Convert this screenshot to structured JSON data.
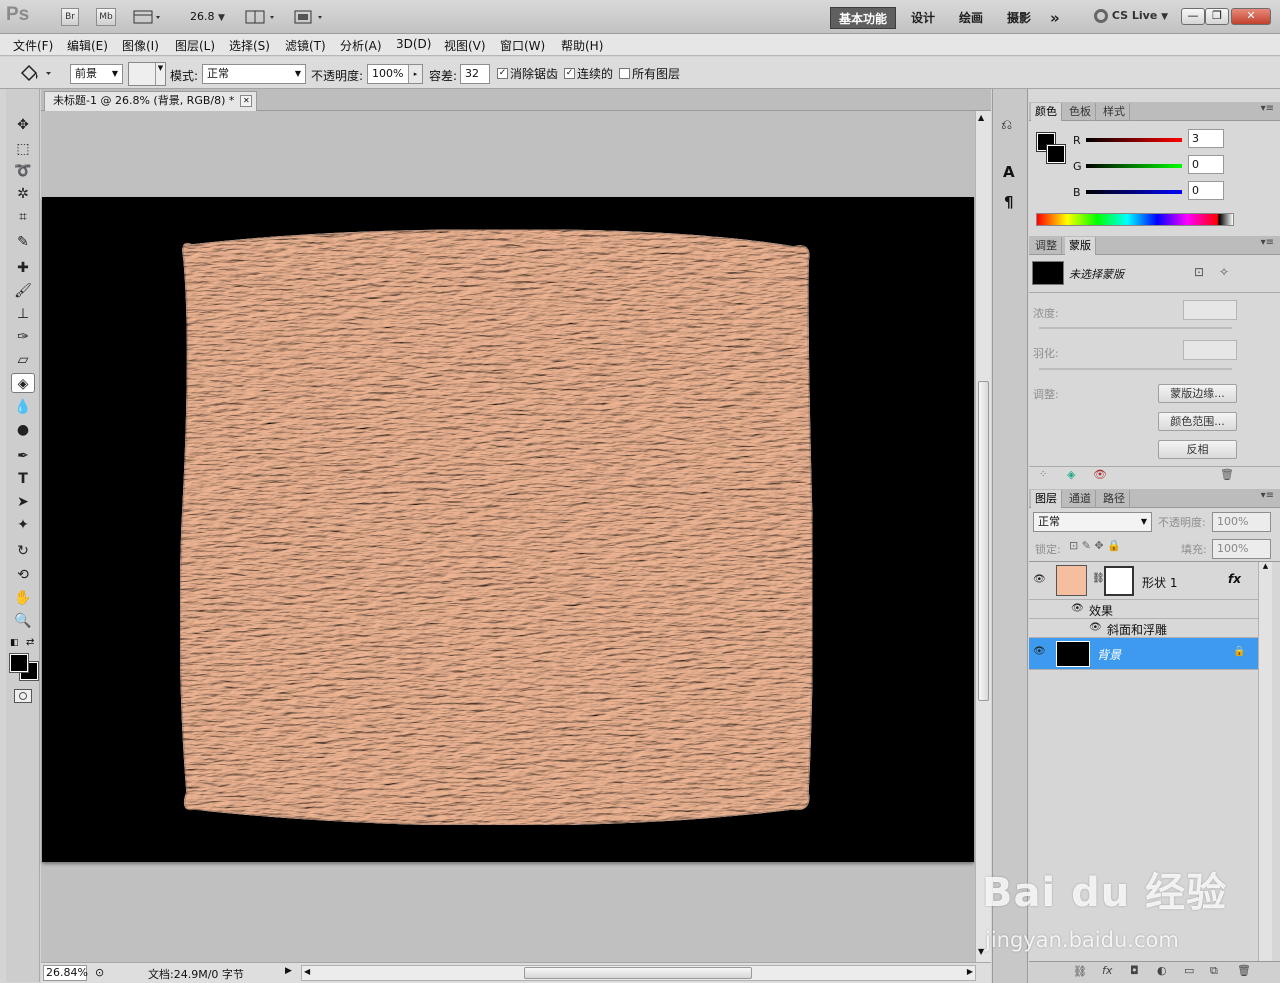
{
  "app": {
    "logo": "Ps",
    "br_label": "Br",
    "mb_label": "Mb",
    "zoom_value": "26.8",
    "cs_live": "CS Live"
  },
  "workspaces": [
    "基本功能",
    "设计",
    "绘画",
    "摄影"
  ],
  "workspace_more": "»",
  "menu": [
    "文件(F)",
    "编辑(E)",
    "图像(I)",
    "图层(L)",
    "选择(S)",
    "滤镜(T)",
    "分析(A)",
    "3D(D)",
    "视图(V)",
    "窗口(W)",
    "帮助(H)"
  ],
  "options": {
    "fill_source": "前景",
    "mode_label": "模式:",
    "mode_value": "正常",
    "opacity_label": "不透明度:",
    "opacity_value": "100%",
    "tolerance_label": "容差:",
    "tolerance_value": "32",
    "antialias_label": "消除锯齿",
    "antialias_checked": true,
    "contiguous_label": "连续的",
    "contiguous_checked": true,
    "all_layers_label": "所有图层",
    "all_layers_checked": false
  },
  "document": {
    "tab_title": "未标题-1 @ 26.8% (背景, RGB/8) *"
  },
  "status": {
    "zoom": "26.84%",
    "doc_info": "文档:24.9M/0 字节"
  },
  "color_panel": {
    "tabs": [
      "颜色",
      "色板",
      "样式"
    ],
    "r_label": "R",
    "g_label": "G",
    "b_label": "B",
    "r_value": "3",
    "g_value": "0",
    "b_value": "0"
  },
  "mask_panel": {
    "tabs": [
      "调整",
      "蒙版"
    ],
    "no_mask_label": "未选择蒙版",
    "density_label": "浓度:",
    "feather_label": "羽化:",
    "refine_label": "调整:",
    "mask_edge_button": "蒙版边缘...",
    "color_range_button": "颜色范围...",
    "invert_button": "反相"
  },
  "layers_panel": {
    "tabs": [
      "图层",
      "通道",
      "路径"
    ],
    "blend_mode": "正常",
    "opacity_label": "不透明度:",
    "opacity_value": "100%",
    "lock_label": "锁定:",
    "fill_label": "填充:",
    "fill_value": "100%",
    "layers": [
      {
        "name": "形状 1",
        "fx": "fx",
        "selected": false
      },
      {
        "name": "背景",
        "selected": true
      }
    ],
    "effects_label": "效果",
    "effect_name": "斜面和浮雕"
  },
  "colors": {
    "shape_fill": "#f2b896",
    "canvas_bg": "#000000",
    "selection_blue": "#3d9aef",
    "workspace_active": "#5f5f5f"
  },
  "watermark": {
    "brand": "Bai du 经验",
    "url": "jingyan.baidu.com"
  }
}
